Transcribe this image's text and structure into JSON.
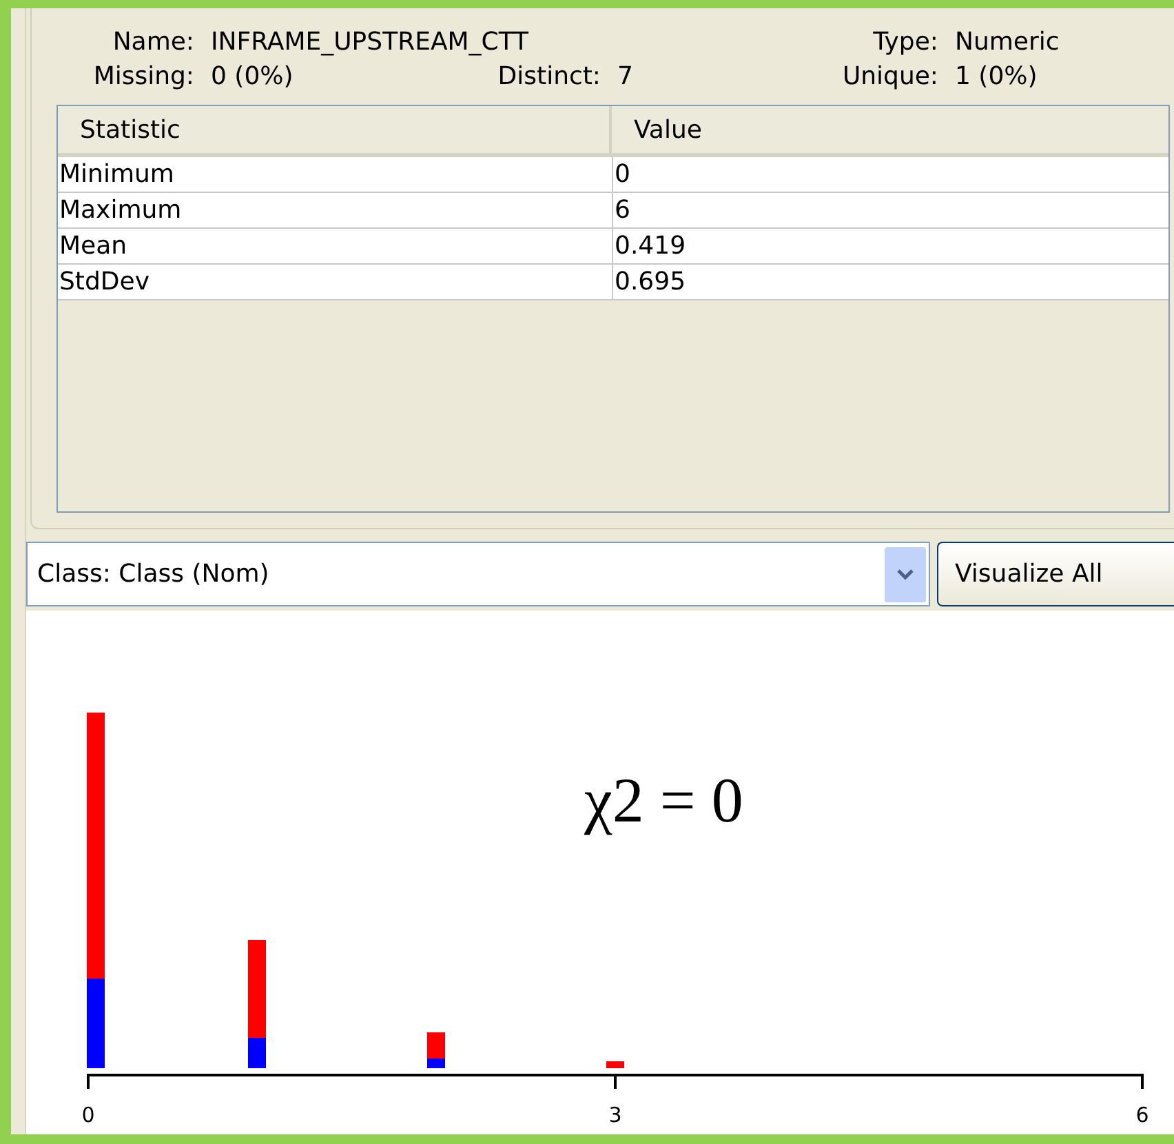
{
  "attribute": {
    "name_label": "Name:",
    "name": "INFRAME_UPSTREAM_CTT",
    "type_label": "Type:",
    "type": "Numeric",
    "missing_label": "Missing:",
    "missing": "0 (0%)",
    "distinct_label": "Distinct:",
    "distinct": "7",
    "unique_label": "Unique:",
    "unique": "1 (0%)"
  },
  "table": {
    "columns": [
      "Statistic",
      "Value"
    ],
    "rows": [
      [
        "Minimum",
        "0"
      ],
      [
        "Maximum",
        "6"
      ],
      [
        "Mean",
        "0.419"
      ],
      [
        "StdDev",
        "0.695"
      ]
    ]
  },
  "class_select": {
    "value": "Class: Class (Nom)"
  },
  "visualize_button": "Visualize All",
  "histogram": {
    "ticks": [
      "0",
      "3",
      "6"
    ],
    "annotation": "χ2 = 0"
  }
}
